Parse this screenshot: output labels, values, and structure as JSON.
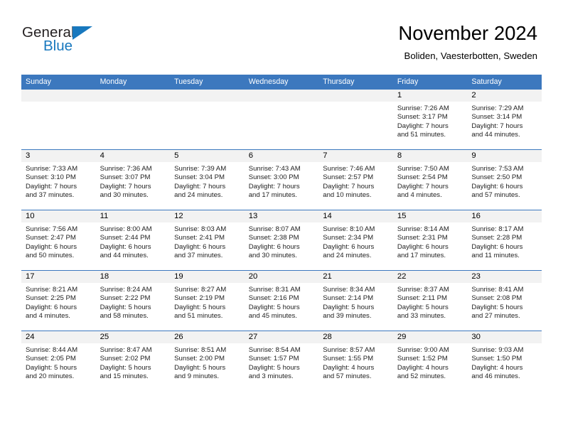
{
  "brand": {
    "name_part1": "General",
    "name_part2": "Blue",
    "accent_color": "#1878be",
    "logo_icon": "triangle-flag-icon"
  },
  "header": {
    "title": "November 2024",
    "location": "Boliden, Vaesterbotten, Sweden"
  },
  "theme": {
    "header_row_color": "#3c78be",
    "daynum_strip_color": "#f2f2f2",
    "row_divider_color": "#3c78be"
  },
  "calendar": {
    "weekday_headers": [
      "Sunday",
      "Monday",
      "Tuesday",
      "Wednesday",
      "Thursday",
      "Friday",
      "Saturday"
    ],
    "weeks": [
      [
        {
          "day": "",
          "sunrise": "",
          "sunset": "",
          "daylight_line1": "",
          "daylight_line2": ""
        },
        {
          "day": "",
          "sunrise": "",
          "sunset": "",
          "daylight_line1": "",
          "daylight_line2": ""
        },
        {
          "day": "",
          "sunrise": "",
          "sunset": "",
          "daylight_line1": "",
          "daylight_line2": ""
        },
        {
          "day": "",
          "sunrise": "",
          "sunset": "",
          "daylight_line1": "",
          "daylight_line2": ""
        },
        {
          "day": "",
          "sunrise": "",
          "sunset": "",
          "daylight_line1": "",
          "daylight_line2": ""
        },
        {
          "day": "1",
          "sunrise": "Sunrise: 7:26 AM",
          "sunset": "Sunset: 3:17 PM",
          "daylight_line1": "Daylight: 7 hours",
          "daylight_line2": "and 51 minutes."
        },
        {
          "day": "2",
          "sunrise": "Sunrise: 7:29 AM",
          "sunset": "Sunset: 3:14 PM",
          "daylight_line1": "Daylight: 7 hours",
          "daylight_line2": "and 44 minutes."
        }
      ],
      [
        {
          "day": "3",
          "sunrise": "Sunrise: 7:33 AM",
          "sunset": "Sunset: 3:10 PM",
          "daylight_line1": "Daylight: 7 hours",
          "daylight_line2": "and 37 minutes."
        },
        {
          "day": "4",
          "sunrise": "Sunrise: 7:36 AM",
          "sunset": "Sunset: 3:07 PM",
          "daylight_line1": "Daylight: 7 hours",
          "daylight_line2": "and 30 minutes."
        },
        {
          "day": "5",
          "sunrise": "Sunrise: 7:39 AM",
          "sunset": "Sunset: 3:04 PM",
          "daylight_line1": "Daylight: 7 hours",
          "daylight_line2": "and 24 minutes."
        },
        {
          "day": "6",
          "sunrise": "Sunrise: 7:43 AM",
          "sunset": "Sunset: 3:00 PM",
          "daylight_line1": "Daylight: 7 hours",
          "daylight_line2": "and 17 minutes."
        },
        {
          "day": "7",
          "sunrise": "Sunrise: 7:46 AM",
          "sunset": "Sunset: 2:57 PM",
          "daylight_line1": "Daylight: 7 hours",
          "daylight_line2": "and 10 minutes."
        },
        {
          "day": "8",
          "sunrise": "Sunrise: 7:50 AM",
          "sunset": "Sunset: 2:54 PM",
          "daylight_line1": "Daylight: 7 hours",
          "daylight_line2": "and 4 minutes."
        },
        {
          "day": "9",
          "sunrise": "Sunrise: 7:53 AM",
          "sunset": "Sunset: 2:50 PM",
          "daylight_line1": "Daylight: 6 hours",
          "daylight_line2": "and 57 minutes."
        }
      ],
      [
        {
          "day": "10",
          "sunrise": "Sunrise: 7:56 AM",
          "sunset": "Sunset: 2:47 PM",
          "daylight_line1": "Daylight: 6 hours",
          "daylight_line2": "and 50 minutes."
        },
        {
          "day": "11",
          "sunrise": "Sunrise: 8:00 AM",
          "sunset": "Sunset: 2:44 PM",
          "daylight_line1": "Daylight: 6 hours",
          "daylight_line2": "and 44 minutes."
        },
        {
          "day": "12",
          "sunrise": "Sunrise: 8:03 AM",
          "sunset": "Sunset: 2:41 PM",
          "daylight_line1": "Daylight: 6 hours",
          "daylight_line2": "and 37 minutes."
        },
        {
          "day": "13",
          "sunrise": "Sunrise: 8:07 AM",
          "sunset": "Sunset: 2:38 PM",
          "daylight_line1": "Daylight: 6 hours",
          "daylight_line2": "and 30 minutes."
        },
        {
          "day": "14",
          "sunrise": "Sunrise: 8:10 AM",
          "sunset": "Sunset: 2:34 PM",
          "daylight_line1": "Daylight: 6 hours",
          "daylight_line2": "and 24 minutes."
        },
        {
          "day": "15",
          "sunrise": "Sunrise: 8:14 AM",
          "sunset": "Sunset: 2:31 PM",
          "daylight_line1": "Daylight: 6 hours",
          "daylight_line2": "and 17 minutes."
        },
        {
          "day": "16",
          "sunrise": "Sunrise: 8:17 AM",
          "sunset": "Sunset: 2:28 PM",
          "daylight_line1": "Daylight: 6 hours",
          "daylight_line2": "and 11 minutes."
        }
      ],
      [
        {
          "day": "17",
          "sunrise": "Sunrise: 8:21 AM",
          "sunset": "Sunset: 2:25 PM",
          "daylight_line1": "Daylight: 6 hours",
          "daylight_line2": "and 4 minutes."
        },
        {
          "day": "18",
          "sunrise": "Sunrise: 8:24 AM",
          "sunset": "Sunset: 2:22 PM",
          "daylight_line1": "Daylight: 5 hours",
          "daylight_line2": "and 58 minutes."
        },
        {
          "day": "19",
          "sunrise": "Sunrise: 8:27 AM",
          "sunset": "Sunset: 2:19 PM",
          "daylight_line1": "Daylight: 5 hours",
          "daylight_line2": "and 51 minutes."
        },
        {
          "day": "20",
          "sunrise": "Sunrise: 8:31 AM",
          "sunset": "Sunset: 2:16 PM",
          "daylight_line1": "Daylight: 5 hours",
          "daylight_line2": "and 45 minutes."
        },
        {
          "day": "21",
          "sunrise": "Sunrise: 8:34 AM",
          "sunset": "Sunset: 2:14 PM",
          "daylight_line1": "Daylight: 5 hours",
          "daylight_line2": "and 39 minutes."
        },
        {
          "day": "22",
          "sunrise": "Sunrise: 8:37 AM",
          "sunset": "Sunset: 2:11 PM",
          "daylight_line1": "Daylight: 5 hours",
          "daylight_line2": "and 33 minutes."
        },
        {
          "day": "23",
          "sunrise": "Sunrise: 8:41 AM",
          "sunset": "Sunset: 2:08 PM",
          "daylight_line1": "Daylight: 5 hours",
          "daylight_line2": "and 27 minutes."
        }
      ],
      [
        {
          "day": "24",
          "sunrise": "Sunrise: 8:44 AM",
          "sunset": "Sunset: 2:05 PM",
          "daylight_line1": "Daylight: 5 hours",
          "daylight_line2": "and 20 minutes."
        },
        {
          "day": "25",
          "sunrise": "Sunrise: 8:47 AM",
          "sunset": "Sunset: 2:02 PM",
          "daylight_line1": "Daylight: 5 hours",
          "daylight_line2": "and 15 minutes."
        },
        {
          "day": "26",
          "sunrise": "Sunrise: 8:51 AM",
          "sunset": "Sunset: 2:00 PM",
          "daylight_line1": "Daylight: 5 hours",
          "daylight_line2": "and 9 minutes."
        },
        {
          "day": "27",
          "sunrise": "Sunrise: 8:54 AM",
          "sunset": "Sunset: 1:57 PM",
          "daylight_line1": "Daylight: 5 hours",
          "daylight_line2": "and 3 minutes."
        },
        {
          "day": "28",
          "sunrise": "Sunrise: 8:57 AM",
          "sunset": "Sunset: 1:55 PM",
          "daylight_line1": "Daylight: 4 hours",
          "daylight_line2": "and 57 minutes."
        },
        {
          "day": "29",
          "sunrise": "Sunrise: 9:00 AM",
          "sunset": "Sunset: 1:52 PM",
          "daylight_line1": "Daylight: 4 hours",
          "daylight_line2": "and 52 minutes."
        },
        {
          "day": "30",
          "sunrise": "Sunrise: 9:03 AM",
          "sunset": "Sunset: 1:50 PM",
          "daylight_line1": "Daylight: 4 hours",
          "daylight_line2": "and 46 minutes."
        }
      ]
    ]
  }
}
